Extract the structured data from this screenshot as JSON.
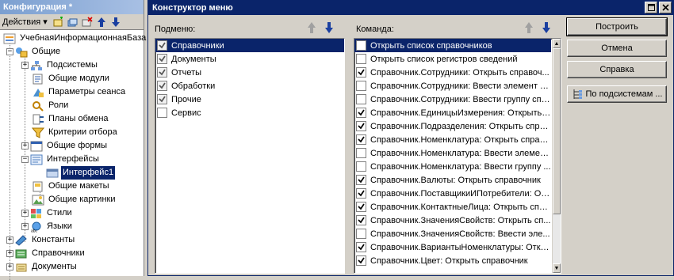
{
  "config_window": {
    "title": "Конфигурация *",
    "actions_label": "Действия",
    "toolbar_icons": [
      "add-icon",
      "add-group-icon",
      "delete-icon",
      "move-up-icon",
      "move-down-icon"
    ],
    "tree": [
      {
        "label": "УчебнаяИнформационнаяБаза",
        "icon": "config-icon"
      },
      {
        "label": "Общие",
        "icon": "common-icon"
      },
      {
        "label": "Подсистемы",
        "icon": "subsystems-icon"
      },
      {
        "label": "Общие модули",
        "icon": "module-icon"
      },
      {
        "label": "Параметры сеанса",
        "icon": "session-params-icon"
      },
      {
        "label": "Роли",
        "icon": "role-icon"
      },
      {
        "label": "Планы обмена",
        "icon": "exchange-plan-icon"
      },
      {
        "label": "Критерии отбора",
        "icon": "filter-criteria-icon"
      },
      {
        "label": "Общие формы",
        "icon": "form-icon"
      },
      {
        "label": "Интерфейсы",
        "icon": "interface-icon"
      },
      {
        "label": "Интерфейс1",
        "icon": "interface-item-icon"
      },
      {
        "label": "Общие макеты",
        "icon": "template-icon"
      },
      {
        "label": "Общие картинки",
        "icon": "picture-icon"
      },
      {
        "label": "Стили",
        "icon": "style-icon"
      },
      {
        "label": "Языки",
        "icon": "language-icon"
      },
      {
        "label": "Константы",
        "icon": "constants-icon"
      },
      {
        "label": "Справочники",
        "icon": "catalogs-icon"
      },
      {
        "label": "Документы",
        "icon": "documents-icon"
      }
    ]
  },
  "dialog": {
    "title": "Конструктор меню",
    "submenu_label": "Подменю:",
    "command_label": "Команда:",
    "submenu_items": [
      {
        "label": "Справочники",
        "checked": true,
        "selected": true
      },
      {
        "label": "Документы",
        "checked": true,
        "selected": false
      },
      {
        "label": "Отчеты",
        "checked": true,
        "selected": false
      },
      {
        "label": "Обработки",
        "checked": true,
        "selected": false
      },
      {
        "label": "Прочие",
        "checked": true,
        "selected": false
      },
      {
        "label": "Сервис",
        "checked": false,
        "selected": false
      }
    ],
    "command_items": [
      {
        "label": "Открыть список справочников",
        "checked": false,
        "selected": true
      },
      {
        "label": "Открыть список регистров сведений",
        "checked": false
      },
      {
        "label": "Справочник.Сотрудники: Открыть справоч...",
        "checked": true
      },
      {
        "label": "Справочник.Сотрудники: Ввести элемент с...",
        "checked": false
      },
      {
        "label": "Справочник.Сотрудники: Ввести группу спр...",
        "checked": false
      },
      {
        "label": "Справочник.ЕдиницыИзмерения: Открыть ...",
        "checked": true
      },
      {
        "label": "Справочник.Подразделения: Открыть справ...",
        "checked": true
      },
      {
        "label": "Справочник.Номенклатура: Открыть справ...",
        "checked": true
      },
      {
        "label": "Справочник.Номенклатура: Ввести элемен...",
        "checked": false
      },
      {
        "label": "Справочник.Номенклатура: Ввести группу ...",
        "checked": false
      },
      {
        "label": "Справочник.Валюты: Открыть справочник",
        "checked": true
      },
      {
        "label": "Справочник.ПоставщикиИПотребители: От...",
        "checked": true
      },
      {
        "label": "Справочник.КонтактныеЛица: Открыть спр...",
        "checked": true
      },
      {
        "label": "Справочник.ЗначенияСвойств: Открыть сп...",
        "checked": true
      },
      {
        "label": "Справочник.ЗначенияСвойств: Ввести эле...",
        "checked": false
      },
      {
        "label": "Справочник.ВариантыНоменклатуры: Откр...",
        "checked": true
      },
      {
        "label": "Справочник.Цвет: Открыть справочник",
        "checked": true
      }
    ],
    "buttons": {
      "build": "Построить",
      "cancel": "Отмена",
      "help": "Справка",
      "by_subsystems": "По подсистемам ..."
    }
  },
  "colors": {
    "selection": "#0a246a",
    "dialog_bg": "#d4d0c8",
    "arrow_active": "#1a3fa0",
    "arrow_disabled": "#a0a0a0"
  }
}
